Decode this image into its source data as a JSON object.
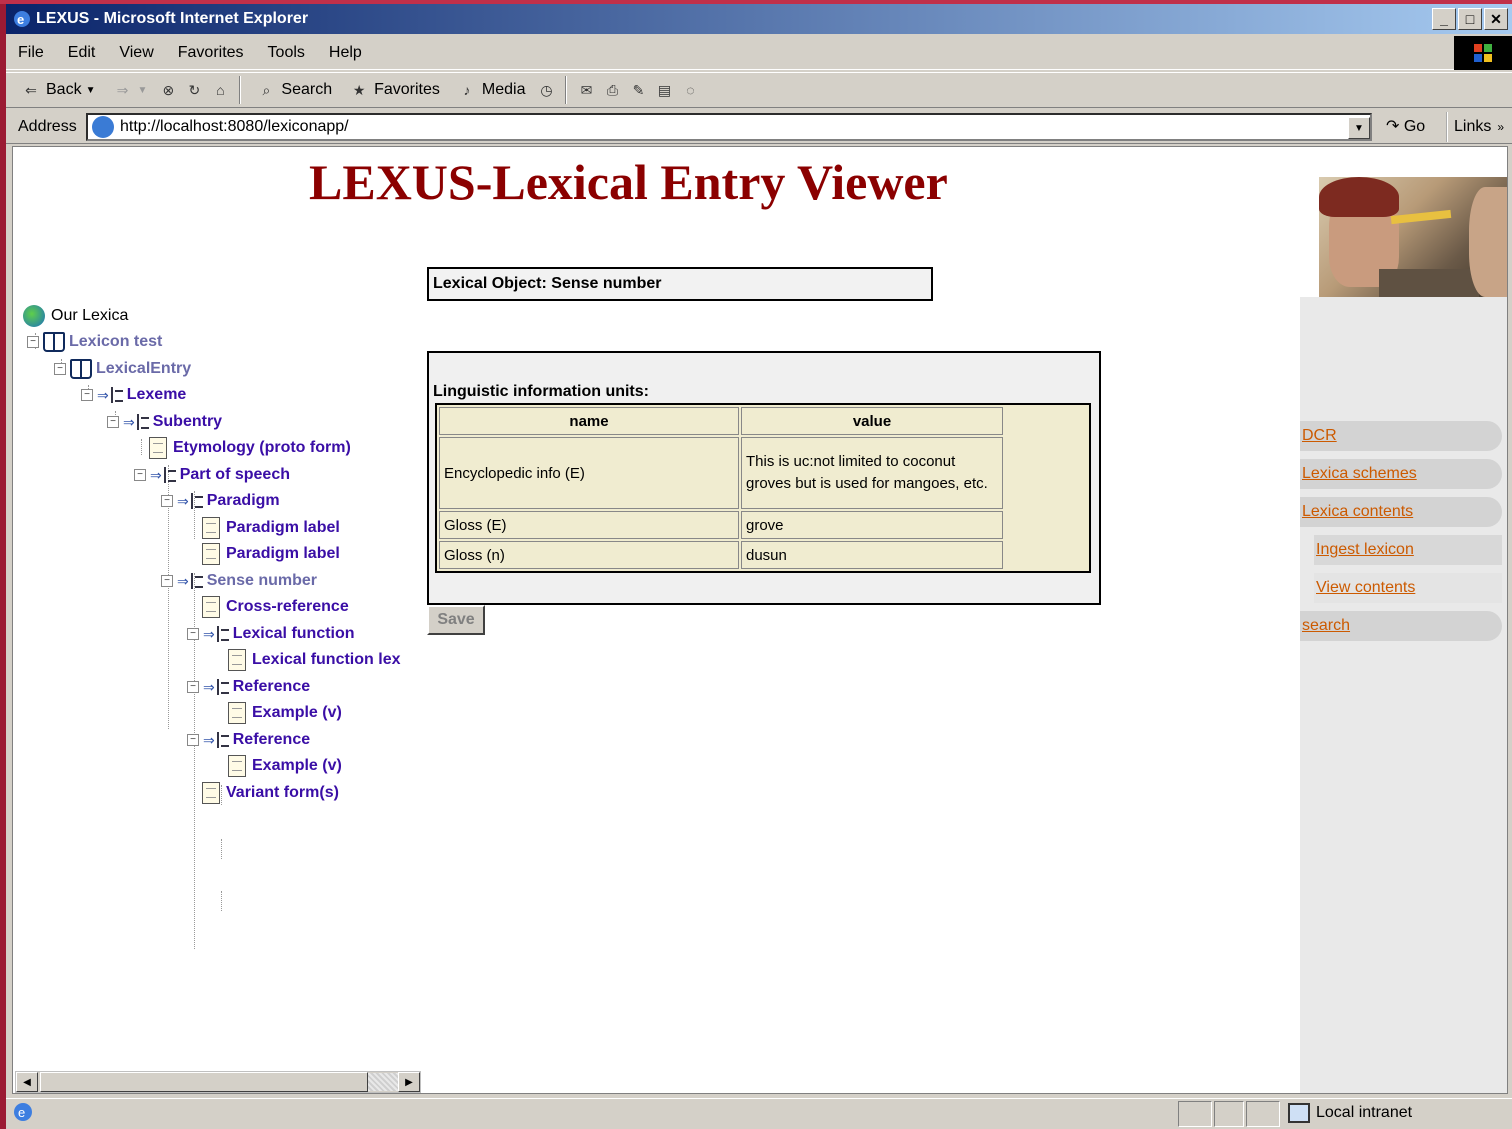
{
  "window": {
    "title": "LEXUS - Microsoft Internet Explorer",
    "controls": [
      "_",
      "□",
      "✕"
    ]
  },
  "menu": [
    "File",
    "Edit",
    "View",
    "Favorites",
    "Tools",
    "Help"
  ],
  "toolbar": {
    "back": "Back",
    "search": "Search",
    "favorites": "Favorites",
    "media": "Media"
  },
  "address": {
    "label": "Address",
    "url": "http://localhost:8080/lexiconapp/",
    "go": "Go",
    "links": "Links"
  },
  "page": {
    "title": "LEXUS-Lexical Entry Viewer"
  },
  "tree": {
    "root": "Our Lexica",
    "nodes": [
      "Lexicon test",
      "LexicalEntry",
      "Lexeme",
      "Subentry",
      "Etymology (proto form)",
      "Part of speech",
      "Paradigm",
      "Paradigm label",
      "Paradigm label",
      "Sense number",
      "Cross-reference",
      "Lexical function",
      "Lexical function lex",
      "Reference",
      "Example (v)",
      "Reference",
      "Example (v)",
      "Variant form(s)"
    ]
  },
  "lexical_object": {
    "label": "Lexical Object: Sense number"
  },
  "linguistic": {
    "title": "Linguistic information units:",
    "headers": {
      "name": "name",
      "value": "value"
    },
    "rows": [
      {
        "name": "Encyclopedic info (E)",
        "value": "This is uc:not limited to coconut groves but is used for mangoes, etc."
      },
      {
        "name": "Gloss (E)",
        "value": "grove"
      },
      {
        "name": "Gloss (n)",
        "value": "dusun"
      }
    ],
    "save": "Save"
  },
  "sidebar": {
    "items": [
      "DCR",
      "Lexica schemes",
      "Lexica contents",
      "Ingest lexicon",
      "View contents",
      "search"
    ]
  },
  "status": {
    "zone": "Local intranet"
  },
  "colors": {
    "title_red": "#8b0000",
    "tree_blue": "#3a0ea6",
    "link_orange": "#cc5a00",
    "titlebar_start": "#0a246a"
  }
}
